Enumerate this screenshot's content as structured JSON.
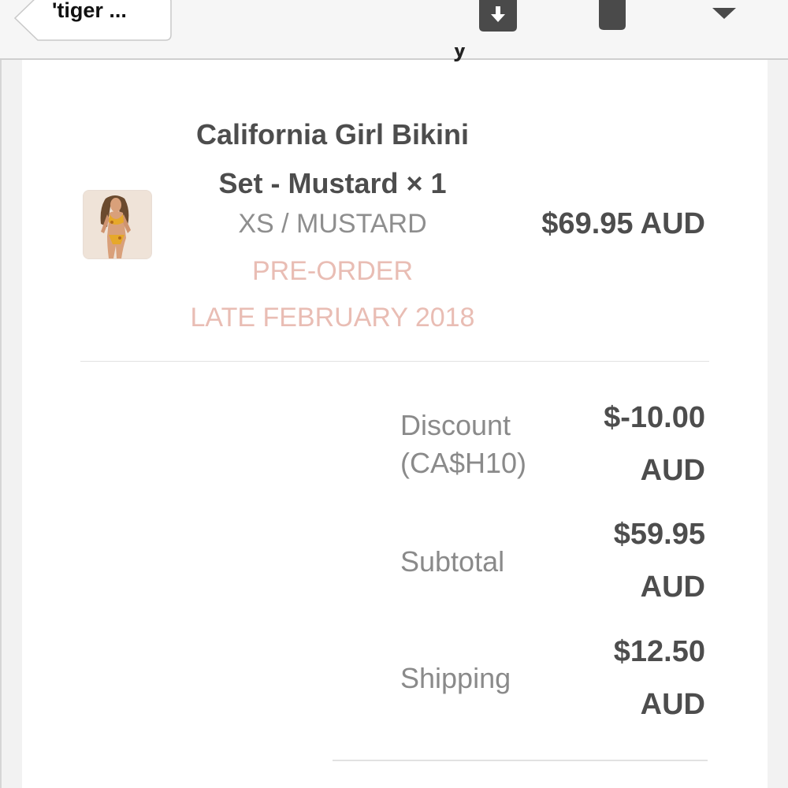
{
  "toolbar": {
    "back_label": "'tiger ...",
    "icons": [
      "archive-download-icon",
      "trash-icon",
      "chevron-down-icon"
    ]
  },
  "cutoff_text": "y",
  "item": {
    "name_line1": "California Girl Bikini",
    "name_line2": "Set - Mustard × 1",
    "variant": "XS / MUSTARD",
    "preorder": "PRE-ORDER",
    "ship_date": "LATE FEBRUARY 2018",
    "price": "$69.95 AUD"
  },
  "summary": {
    "discount_label_1": "Discount",
    "discount_label_2": "(CA$H10)",
    "discount_value_1": "$-10.00",
    "discount_value_2": "AUD",
    "subtotal_label": "Subtotal",
    "subtotal_value_1": "$59.95",
    "subtotal_value_2": "AUD",
    "shipping_label": "Shipping",
    "shipping_value_1": "$12.50",
    "shipping_value_2": "AUD"
  },
  "colors": {
    "accent_pink": "#e9bdb4",
    "text_dark": "#4d4d4d",
    "text_gray": "#8a8a8a"
  }
}
